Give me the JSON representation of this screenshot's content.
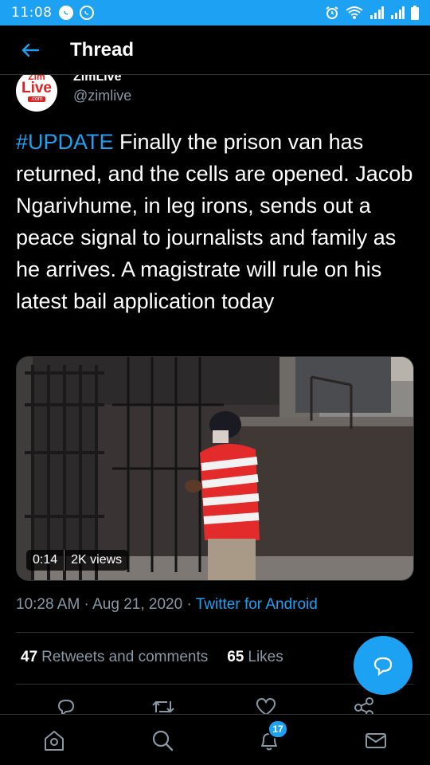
{
  "status_bar": {
    "time": "11:08",
    "icons": [
      "whatsapp-icon",
      "whatsapp-outline-icon",
      "alarm-icon",
      "wifi-icon",
      "signal-icon",
      "signal-icon",
      "battery-icon"
    ]
  },
  "header": {
    "title": "Thread",
    "back_icon": "arrow-left-icon"
  },
  "author": {
    "name": "ZimLive",
    "handle": "@zimlive",
    "avatar_text": {
      "top": "Zim",
      "main": "Live",
      "sub": ".com"
    }
  },
  "tweet": {
    "hashtag": "#UPDATE",
    "body": " Finally the prison van has returned, and the cells are opened. Jacob Ngarivhume, in leg irons, sends out a peace signal to journalists and family as he arrives. A magistrate will rule on his latest bail application today"
  },
  "media": {
    "duration": "0:14",
    "views": "2K views"
  },
  "meta": {
    "time": "10:28 AM",
    "separator": " · ",
    "date": "Aug 21, 2020",
    "source": "Twitter for Android"
  },
  "stats": {
    "retweets_count": "47",
    "retweets_label": "Retweets and comments",
    "likes_count": "65",
    "likes_label": "Likes"
  },
  "actions": [
    "reply-icon",
    "retweet-icon",
    "like-icon",
    "share-icon"
  ],
  "fab": {
    "icon": "compose-reply-icon"
  },
  "bottom_nav": {
    "items": [
      "home-icon",
      "search-icon",
      "notifications-icon",
      "messages-icon"
    ],
    "notification_badge": "17"
  },
  "colors": {
    "accent": "#1da1f2",
    "background": "#000000",
    "secondary_text": "#8899a6",
    "divider": "#2f3336"
  }
}
